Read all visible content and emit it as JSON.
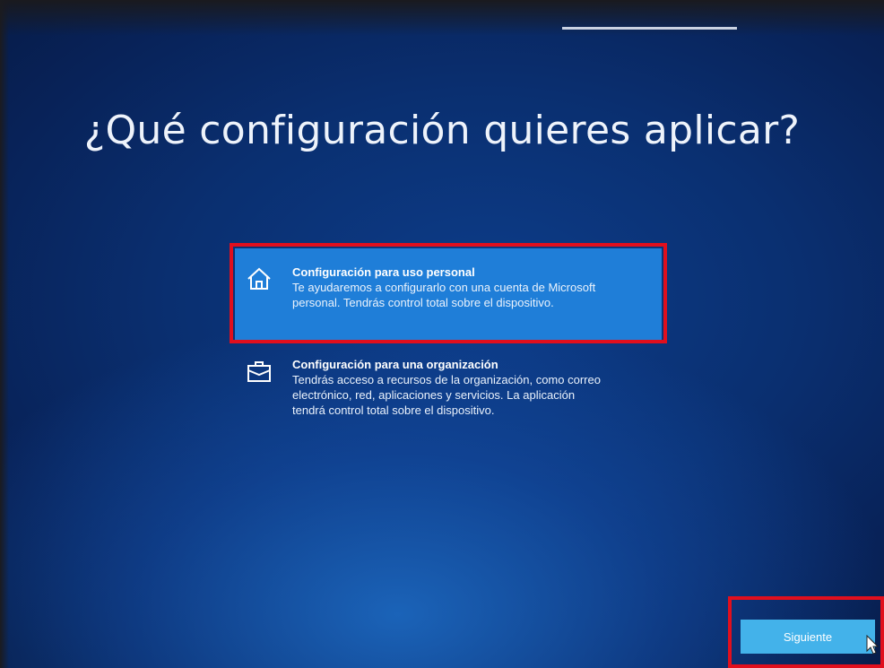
{
  "page": {
    "title": "¿Qué configuración quieres aplicar?"
  },
  "options": [
    {
      "title": "Configuración para uso personal",
      "description": "Te ayudaremos a configurarlo con una cuenta de Microsoft\npersonal. Tendrás control total sobre el dispositivo.",
      "icon": "home-icon",
      "selected": true
    },
    {
      "title": "Configuración para una organización",
      "description": "Tendrás acceso a recursos de la organización, como correo\nelectrónico, red, aplicaciones y servicios. La aplicación\ntendrá control total sobre el dispositivo.",
      "icon": "briefcase-icon",
      "selected": false
    }
  ],
  "footer": {
    "next_label": "Siguiente"
  },
  "colors": {
    "selected_option": "#1f7ed8",
    "next_button": "#43b2ea",
    "highlight": "#e10f1d",
    "background": "#0a2f70"
  }
}
